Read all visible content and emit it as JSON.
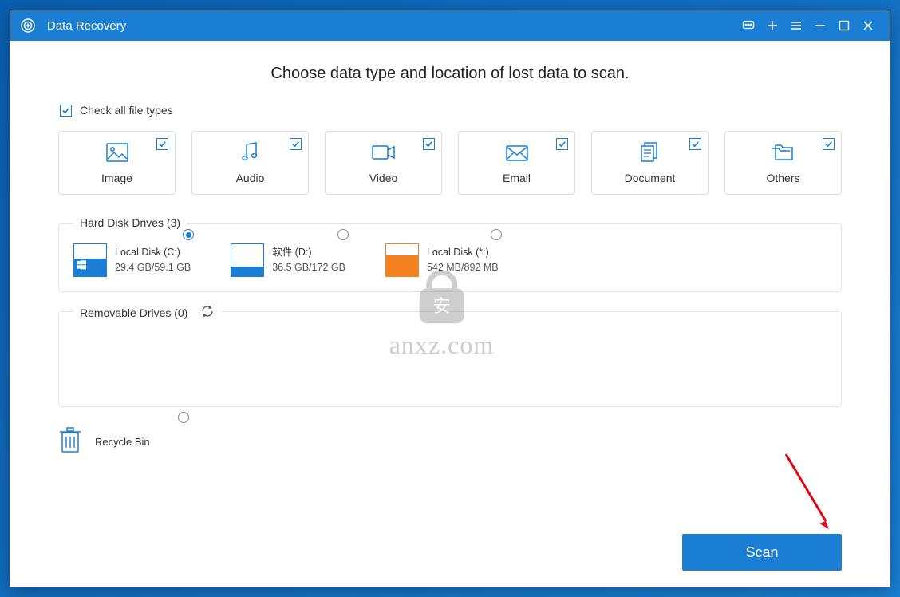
{
  "titlebar": {
    "title": "Data Recovery"
  },
  "heading": "Choose data type and location of lost data to scan.",
  "check_all_label": "Check all file types",
  "types": {
    "image": "Image",
    "audio": "Audio",
    "video": "Video",
    "email": "Email",
    "document": "Document",
    "others": "Others"
  },
  "hdd": {
    "title": "Hard Disk Drives (3)",
    "drives": [
      {
        "name": "Local Disk (C:)",
        "size": "29.4 GB/59.1 GB"
      },
      {
        "name": "软件 (D:)",
        "size": "36.5 GB/172 GB"
      },
      {
        "name": "Local Disk (*:)",
        "size": "542 MB/892 MB"
      }
    ]
  },
  "removable": {
    "title": "Removable Drives (0)"
  },
  "recycle": {
    "label": "Recycle Bin"
  },
  "scan_label": "Scan",
  "watermark": "anxz.com",
  "colors": {
    "accent": "#1a7fd4",
    "orange": "#f58220"
  }
}
